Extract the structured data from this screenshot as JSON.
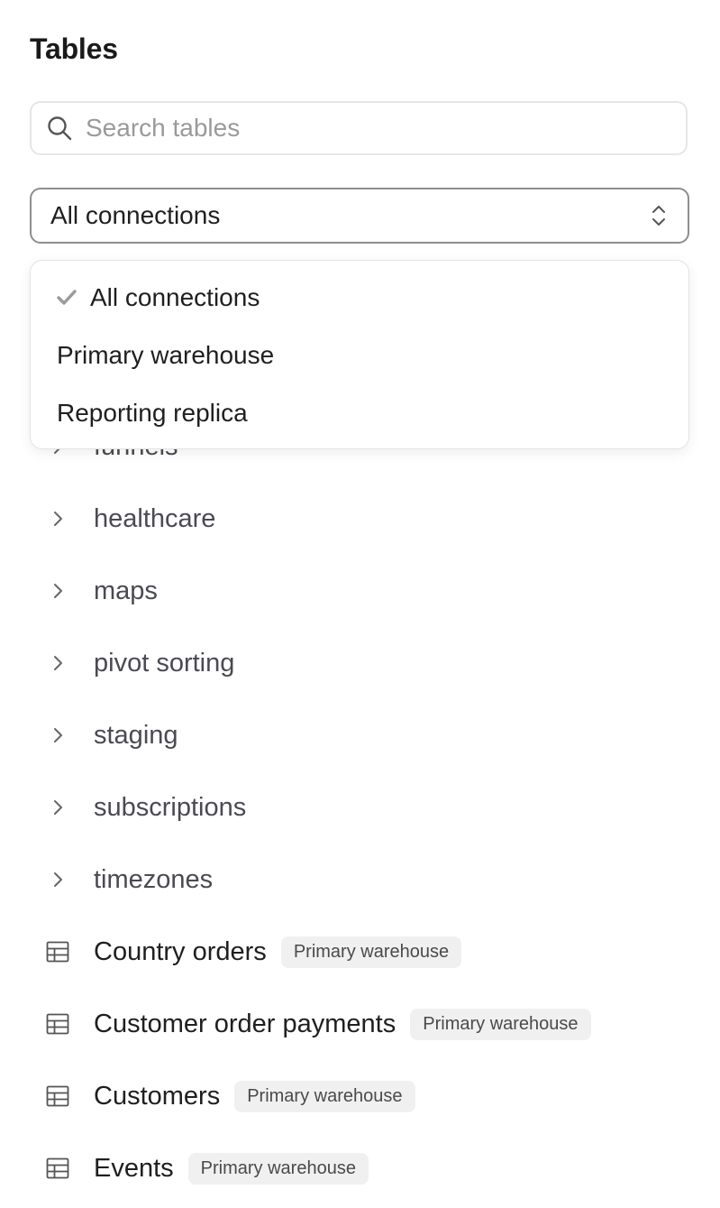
{
  "header": {
    "title": "Tables"
  },
  "search": {
    "placeholder": "Search tables",
    "value": ""
  },
  "connection_select": {
    "selected": "All connections",
    "options": [
      {
        "label": "All connections",
        "selected": true
      },
      {
        "label": "Primary warehouse",
        "selected": false
      },
      {
        "label": "Reporting replica",
        "selected": false
      }
    ]
  },
  "folders": [
    {
      "name": "funnels"
    },
    {
      "name": "healthcare"
    },
    {
      "name": "maps"
    },
    {
      "name": "pivot sorting"
    },
    {
      "name": "staging"
    },
    {
      "name": "subscriptions"
    },
    {
      "name": "timezones"
    }
  ],
  "tables": [
    {
      "name": "Country orders",
      "connection": "Primary warehouse"
    },
    {
      "name": "Customer order payments",
      "connection": "Primary warehouse"
    },
    {
      "name": "Customers",
      "connection": "Primary warehouse"
    },
    {
      "name": "Events",
      "connection": "Primary warehouse"
    }
  ],
  "icons": {
    "search": "search-icon",
    "select": "chevron-up-down-icon",
    "check": "check-icon",
    "folder": "chevron-right-icon",
    "table": "table-icon"
  },
  "colors": {
    "text": "#1f1f1f",
    "muted_text": "#4a4a52",
    "badge_bg": "#f0f0f0",
    "border": "#e6e6e6"
  }
}
